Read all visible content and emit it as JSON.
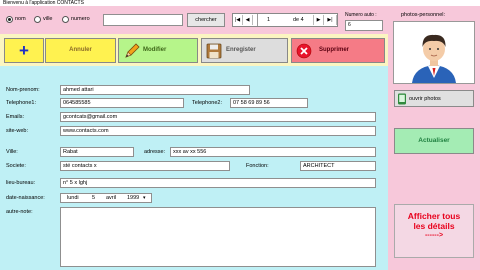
{
  "window": {
    "title": "Bienvenu à l'application CONTACTS"
  },
  "search": {
    "options": [
      "nom",
      "ville",
      "numero"
    ],
    "selected": "nom",
    "value": "",
    "button": "chercher"
  },
  "pager": {
    "first": "|◀",
    "prev": "◀",
    "current": "1",
    "of_label": "de 4",
    "next": "▶",
    "last": "▶|"
  },
  "numero_auto": {
    "label": "Numero auto :",
    "value": "6"
  },
  "actions": {
    "add": "+",
    "cancel": "Annuler",
    "edit": "Modifier",
    "save": "Enregister",
    "delete": "Supprimer"
  },
  "form": {
    "nom_prenom": {
      "label": "Nom-prenom:",
      "value": "ahmed attari"
    },
    "telephone1": {
      "label": "Telephone1:",
      "value": "064585585"
    },
    "telephone2": {
      "label": "Telephone2:",
      "value": "07 58 69 89 56"
    },
    "emails": {
      "label": "Emails:",
      "value": "gcontcats@gmail.com"
    },
    "site_web": {
      "label": "site-web:",
      "value": "www.contacts.com"
    },
    "ville": {
      "label": "Ville:",
      "value": "Rabat"
    },
    "adresse": {
      "label": "adresse:",
      "value": "xxx av xx 556"
    },
    "societe": {
      "label": "Societe:",
      "value": "sté contacts x"
    },
    "fonction": {
      "label": "Fonction:",
      "value": "ARCHITECT"
    },
    "lieu_bureau": {
      "label": "lieu-bureau:",
      "value": "n° 5 x lghj"
    },
    "date_naissance": {
      "label": "date-naissance:",
      "day_name": "lundi",
      "day": "5",
      "month": "avril",
      "year": "1999"
    },
    "autre_note": {
      "label": "autre-note:",
      "value": ""
    }
  },
  "photo": {
    "label": "photos-personnel:",
    "open_button": "ouvrir photos",
    "update_button": "Actualiser",
    "details_button_line1": "Afficher tous",
    "details_button_line2": "les détails",
    "details_arrow": "------>"
  },
  "colors": {
    "pink_panel": "#f7c8da",
    "yellow_bar": "#fbf5c1",
    "form_bg": "#bff0f5",
    "add_button": "#fff250",
    "edit_button": "#b6f58a",
    "save_button": "#dddddd",
    "delete_button": "#f57b86",
    "update_button": "#a4ecb4",
    "details_text": "#e8001c"
  }
}
